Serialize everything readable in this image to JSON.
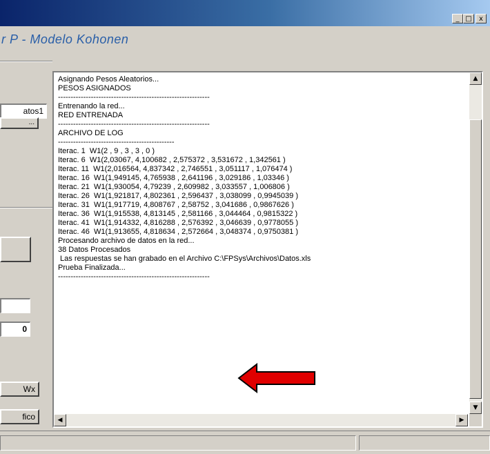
{
  "window": {
    "subtitle": "r P - Modelo Kohonen",
    "controls": {
      "minimize": "_",
      "maximize": "□",
      "close": "x"
    }
  },
  "left_panel": {
    "file_field_value": "atos1",
    "browse_button_label": "...",
    "count_field_value": "0",
    "wx_button_label": "Wx",
    "grafico_button_label": "fico"
  },
  "log": {
    "lines": [
      "Asignando Pesos Aleatorios...",
      "PESOS ASIGNADOS",
      "------------------------------------------------------------",
      "Entrenando la red...",
      "RED ENTRENADA",
      "------------------------------------------------------------",
      "ARCHIVO DE LOG",
      "----------------------------------------------",
      "Iterac. 1  W1(2 , 9 , 3 , 3 , 0 )",
      "Iterac. 6  W1(2,03067, 4,100682 , 2,575372 , 3,531672 , 1,342561 )",
      "Iterac. 11  W1(2,016564, 4,837342 , 2,746551 , 3,051117 , 1,076474 )",
      "Iterac. 16  W1(1,949145, 4,765938 , 2,641196 , 3,029186 , 1,03346 )",
      "Iterac. 21  W1(1,930054, 4,79239 , 2,609982 , 3,033557 , 1,006806 )",
      "Iterac. 26  W1(1,921817, 4,802361 , 2,596437 , 3,038099 , 0,9945039 )",
      "Iterac. 31  W1(1,917719, 4,808767 , 2,58752 , 3,041686 , 0,9867626 )",
      "Iterac. 36  W1(1,915538, 4,813145 , 2,581166 , 3,044464 , 0,9815322 )",
      "Iterac. 41  W1(1,914332, 4,816288 , 2,576392 , 3,046639 , 0,9778055 )",
      "Iterac. 46  W1(1,913655, 4,818634 , 2,572664 , 3,048374 , 0,9750381 )",
      "Procesando archivo de datos en la red...",
      "38 Datos Procesados",
      " Las respuestas se han grabado en el Archivo C:\\FPSys\\Archivos\\Datos.xls",
      "Prueba Finalizada...",
      "------------------------------------------------------------"
    ]
  },
  "colors": {
    "titlebar_start": "#0a246a",
    "titlebar_end": "#a6caf0",
    "subtitle": "#2a5fa8",
    "arrow": "#e00000"
  }
}
